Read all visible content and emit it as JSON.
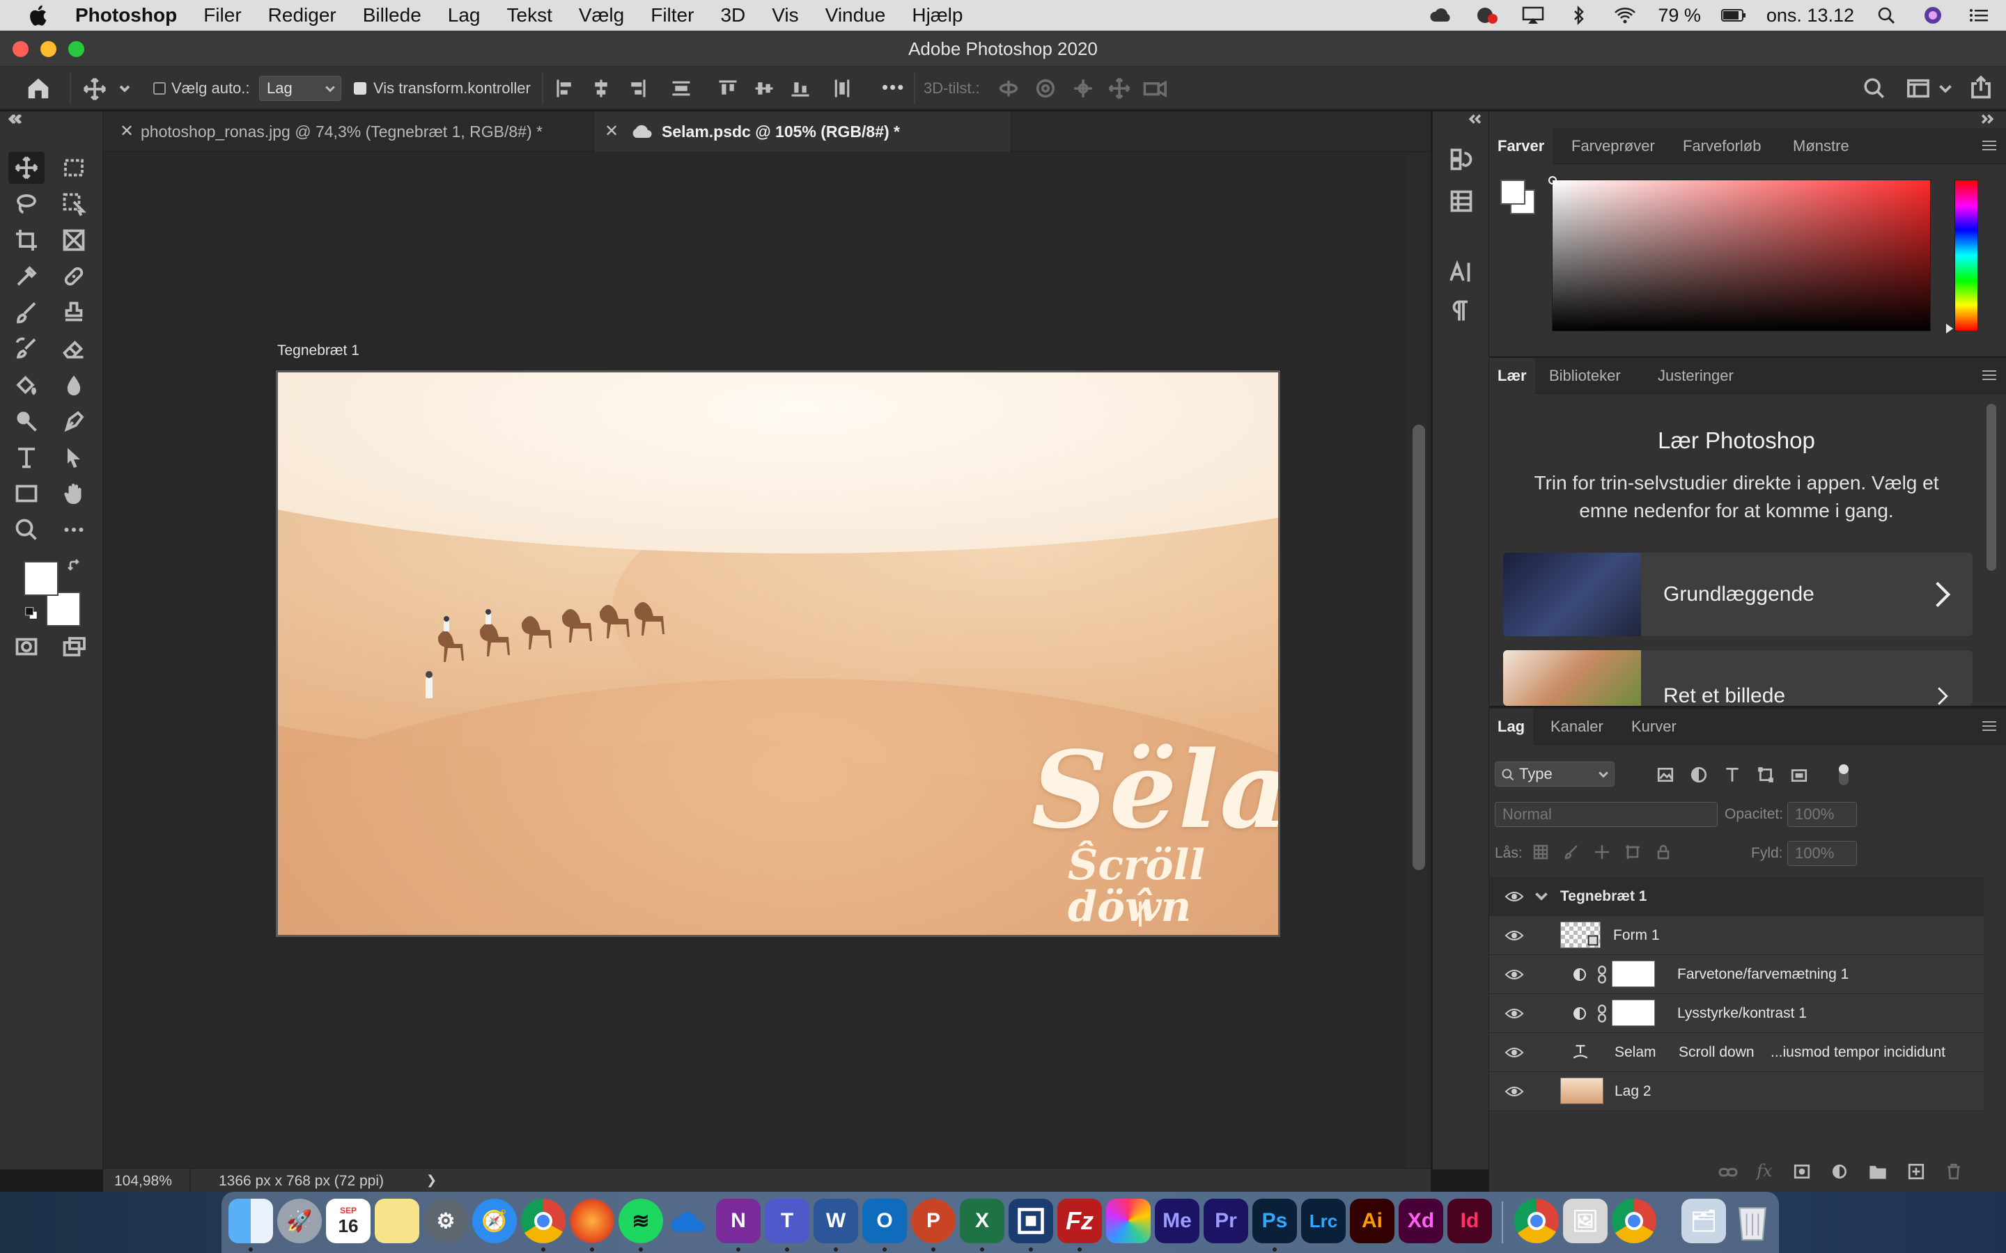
{
  "menubar": {
    "app": "Photoshop",
    "items": [
      "Filer",
      "Rediger",
      "Billede",
      "Lag",
      "Tekst",
      "Vælg",
      "Filter",
      "3D",
      "Vis",
      "Vindue",
      "Hjælp"
    ],
    "battery": "79 %",
    "clock": "ons. 13.12"
  },
  "window": {
    "title": "Adobe Photoshop 2020"
  },
  "options": {
    "auto_select_label": "Vælg auto.:",
    "auto_select_target": "Lag",
    "show_transform_label": "Vis transform.kontroller",
    "mode3d_label": "3D-tilst.:",
    "more": "•••"
  },
  "tabs": [
    {
      "label": "photoshop_ronas.jpg @ 74,3% (Tegnebræt 1, RGB/8#) *"
    },
    {
      "label": "Selam.psdc @ 105% (RGB/8#) *"
    }
  ],
  "canvas": {
    "artboard_label": "Tegnebræt 1",
    "headline": "Sëlam",
    "subline": "Ŝcröll döŵn"
  },
  "status": {
    "zoom": "104,98%",
    "dimensions": "1366 px x 768 px (72 ppi)",
    "arrow": "❯"
  },
  "color_panel": {
    "tabs": [
      "Farver",
      "Farveprøver",
      "Farveforløb",
      "Mønstre"
    ]
  },
  "learn_panel": {
    "tabs": [
      "Lær",
      "Biblioteker",
      "Justeringer"
    ],
    "title": "Lær Photoshop",
    "description": "Trin for trin-selvstudier direkte i appen. Vælg et emne nedenfor for at komme i gang.",
    "cards": [
      {
        "label": "Grundlæggende"
      },
      {
        "label": "Ret et billede"
      }
    ]
  },
  "layers_panel": {
    "tabs": [
      "Lag",
      "Kanaler",
      "Kurver"
    ],
    "filter": "Type",
    "blend_mode": "Normal",
    "opacity_label": "Opacitet:",
    "opacity_value": "100%",
    "lock_label": "Lås:",
    "fill_label": "Fyld:",
    "fill_value": "100%",
    "layers": [
      {
        "name": "Tegnebræt 1"
      },
      {
        "name": "Form 1"
      },
      {
        "name": "Farvetone/farvemætning 1"
      },
      {
        "name": "Lysstyrke/kontrast 1"
      },
      {
        "name": "Selam",
        "name2": "Scroll down",
        "name3": "...iusmod tempor incididunt"
      },
      {
        "name": "Lag 2"
      }
    ]
  },
  "dock": {
    "calendar_month": "SEP",
    "calendar_day": "16",
    "labels": [
      "N",
      "T",
      "W",
      "O",
      "P",
      "X",
      "Me",
      "Pr",
      "Ps",
      "Lrc",
      "Ai",
      "Xd",
      "Id"
    ]
  },
  "colors": {
    "accent_blue": "#2f7de1",
    "panel_bg": "#323232",
    "canvas_bg": "#282828"
  }
}
